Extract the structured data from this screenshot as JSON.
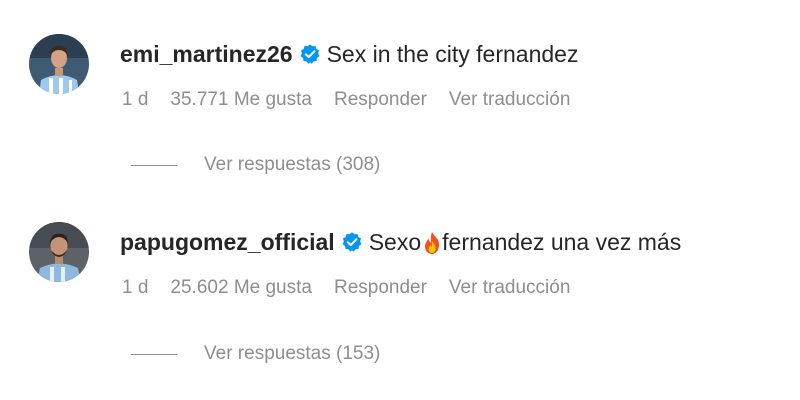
{
  "comments": [
    {
      "username": "emi_martinez26",
      "verified": true,
      "text": "Sex in the city fernandez",
      "time": "1 d",
      "likes": "35.771 Me gusta",
      "reply_label": "Responder",
      "translate_label": "Ver traducción",
      "replies_label": "Ver respuestas (308)"
    },
    {
      "username": "papugomez_official",
      "verified": true,
      "text_before": "Sexo",
      "emoji": "fire",
      "text_after": "fernandez una vez más",
      "time": "1 d",
      "likes": "25.602 Me gusta",
      "reply_label": "Responder",
      "translate_label": "Ver traducción",
      "replies_label": "Ver respuestas (153)"
    }
  ],
  "colors": {
    "text_primary": "#262626",
    "text_secondary": "#8e8e8e",
    "verified_badge": "#0095f6",
    "background": "#ffffff"
  },
  "icons": {
    "verified": "verified-badge-icon",
    "emoji": "fire-emoji-icon"
  }
}
